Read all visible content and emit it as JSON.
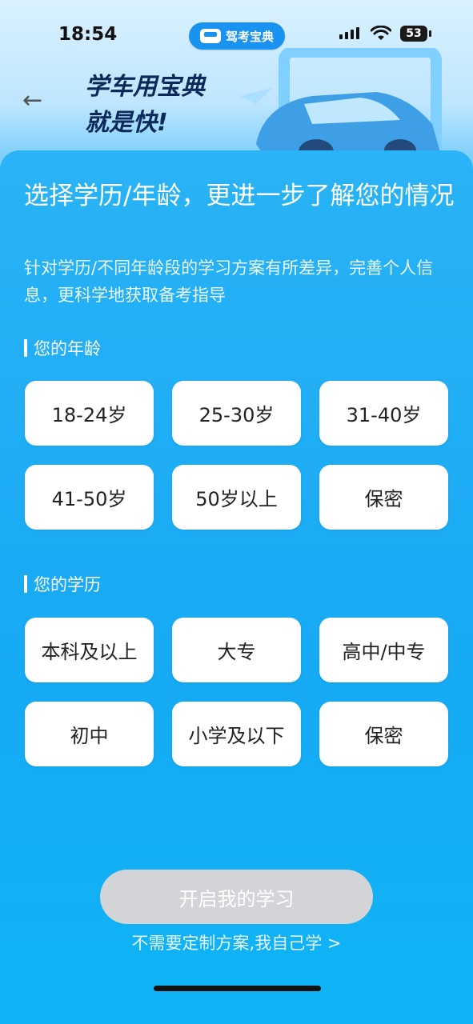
{
  "status": {
    "time": "18:54",
    "app_pill_label": "驾考宝典",
    "battery": "53"
  },
  "banner": {
    "line1": "学车用宝典",
    "line2": "就是快!"
  },
  "intro": {
    "title": "选择学历/年龄，更进一步了解您的情况",
    "subtitle": "针对学历/不同年龄段的学习方案有所差异，完善个人信息，更科学地获取备考指导"
  },
  "age_section": {
    "title": "您的年龄",
    "options": [
      "18-24岁",
      "25-30岁",
      "31-40岁",
      "41-50岁",
      "50岁以上",
      "保密"
    ]
  },
  "edu_section": {
    "title": "您的学历",
    "options": [
      "本科及以上",
      "大专",
      "高中/中专",
      "初中",
      "小学及以下",
      "保密"
    ]
  },
  "footer": {
    "start_label": "开启我的学习",
    "skip_label": "不需要定制方案,我自己学 >"
  },
  "icons": [
    "back-arrow-icon",
    "car-icon",
    "wifi-icon",
    "signal-icon",
    "battery-icon"
  ],
  "colors": {
    "accent": "#16a9f4",
    "disabled_button": "#d2d4d8",
    "headline_dark": "#0b2a5a"
  }
}
